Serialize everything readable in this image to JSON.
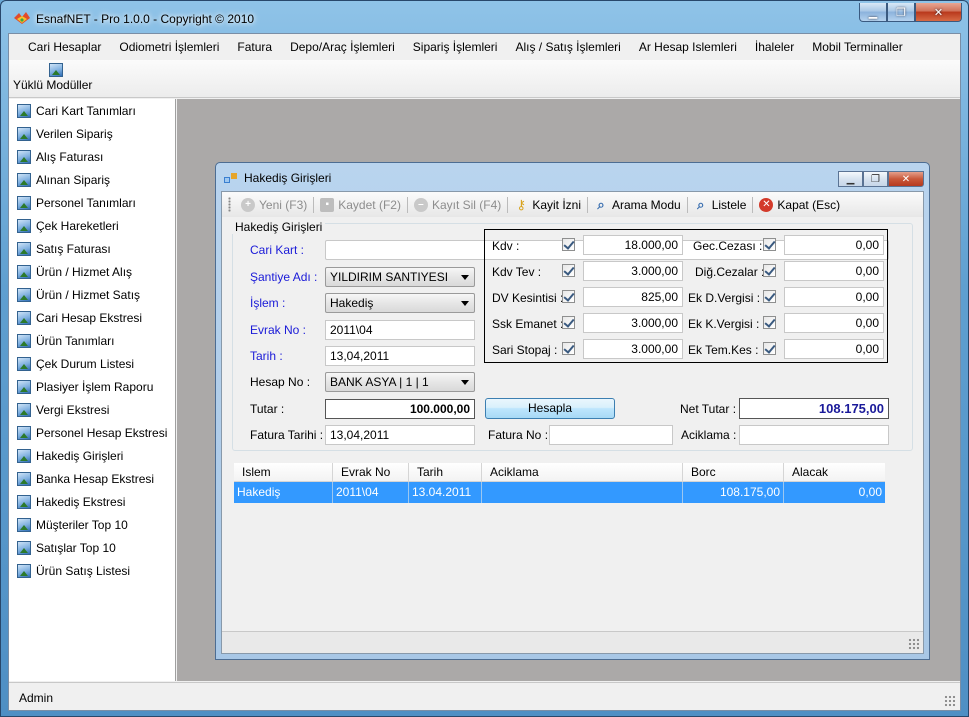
{
  "window": {
    "title": "EsnafNET - Pro 1.0.0 - Copyright ©  2010"
  },
  "menu": [
    "Cari Hesaplar",
    "Odiometri İşlemleri",
    "Fatura",
    "Depo/Araç İşlemleri",
    "Sipariş İşlemleri",
    "Alış / Satış İşlemleri",
    "Ar Hesap Islemleri",
    "İhaleler",
    "Mobil Terminaller"
  ],
  "toolbar": {
    "modules_label": "Yüklü Modüller"
  },
  "sidebar": {
    "items": [
      "Cari Kart Tanımları",
      "Verilen Sipariş",
      "Alış Faturası",
      "Alınan Sipariş",
      "Personel Tanımları",
      "Çek Hareketleri",
      "Satış Faturası",
      "Ürün / Hizmet Alış",
      "Ürün / Hizmet Satış",
      "Cari Hesap Ekstresi",
      "Ürün Tanımları",
      "Çek Durum Listesi",
      "Plasiyer İşlem Raporu",
      "Vergi Ekstresi",
      "Personel Hesap Ekstresi",
      "Hakediş Girişleri",
      "Banka Hesap Ekstresi",
      "Hakediş Ekstresi",
      "Müşteriler Top 10",
      "Satışlar Top 10",
      "Ürün Satış Listesi"
    ]
  },
  "status": {
    "user": "Admin"
  },
  "child": {
    "title": "Hakediş Girişleri",
    "toolbar": {
      "new": "Yeni (F3)",
      "save": "Kaydet (F2)",
      "delete": "Kayıt Sil (F4)",
      "permission": "Kayit İzni",
      "search": "Arama Modu",
      "list": "Listele",
      "close": "Kapat (Esc)"
    },
    "group_title": "Hakediş Girişleri",
    "labels": {
      "cari_kart": "Cari Kart :",
      "santiye": "Şantiye Adı :",
      "islem": "İşlem :",
      "evrak_no": "Evrak No :",
      "tarih": "Tarih :",
      "hesap_no": "Hesap No :",
      "tutar": "Tutar :",
      "fatura_tarihi": "Fatura Tarihi :",
      "fatura_no": "Fatura No :",
      "aciklama": "Aciklama :",
      "net_tutar": "Net Tutar :"
    },
    "values": {
      "cari_kart": "",
      "santiye": "YILDIRIM SANTIYESI",
      "islem": "Hakediş",
      "evrak_no": "2011\\04",
      "tarih": "13,04,2011",
      "hesap_no": "BANK ASYA | 1 | 1",
      "tutar": "100.000,00",
      "fatura_tarihi": "13,04,2011",
      "fatura_no": "",
      "aciklama": "",
      "net_tutar": "108.175,00"
    },
    "taxes_left": [
      {
        "label": "Kdv :",
        "value": "18.000,00"
      },
      {
        "label": "Kdv Tev :",
        "value": "3.000,00"
      },
      {
        "label": "DV Kesintisi :",
        "value": "825,00"
      },
      {
        "label": "Ssk Emanet :",
        "value": "3.000,00"
      },
      {
        "label": "Sari Stopaj :",
        "value": "3.000,00"
      }
    ],
    "taxes_right": [
      {
        "label": "Gec.Cezası :",
        "value": "0,00"
      },
      {
        "label": "Diğ.Cezalar :",
        "value": "0,00"
      },
      {
        "label": "Ek D.Vergisi :",
        "value": "0,00"
      },
      {
        "label": "Ek K.Vergisi :",
        "value": "0,00"
      },
      {
        "label": "Ek Tem.Kes :",
        "value": "0,00"
      }
    ],
    "calc_button": "Hesapla",
    "grid": {
      "headers": [
        "Islem",
        "Evrak No",
        "Tarih",
        "Aciklama",
        "Borc",
        "Alacak"
      ],
      "rows": [
        [
          "Hakediş",
          "2011\\04",
          "13.04.2011",
          "",
          "108.175,00",
          "0,00"
        ]
      ]
    }
  }
}
